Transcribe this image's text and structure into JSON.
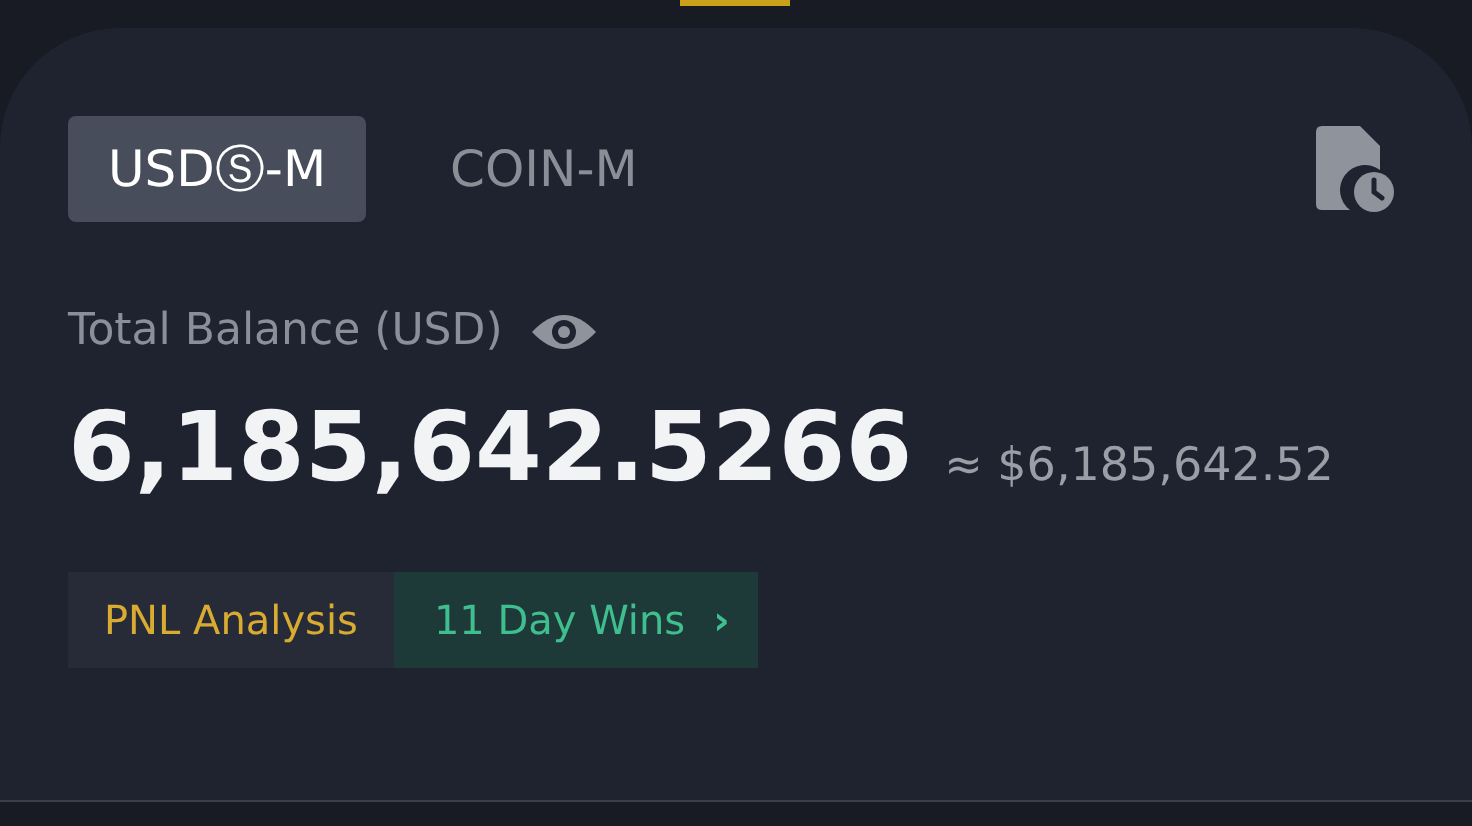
{
  "tabs": [
    {
      "label": "USDⓈ-M",
      "selected": true
    },
    {
      "label": "COIN-M",
      "selected": false
    }
  ],
  "balance": {
    "label": "Total Balance (USD)",
    "amount": "6,185,642.5266",
    "approx": "≈ $6,185,642.52"
  },
  "pnl": {
    "label": "PNL Analysis",
    "streak": "11 Day Wins",
    "arrow": "›"
  }
}
